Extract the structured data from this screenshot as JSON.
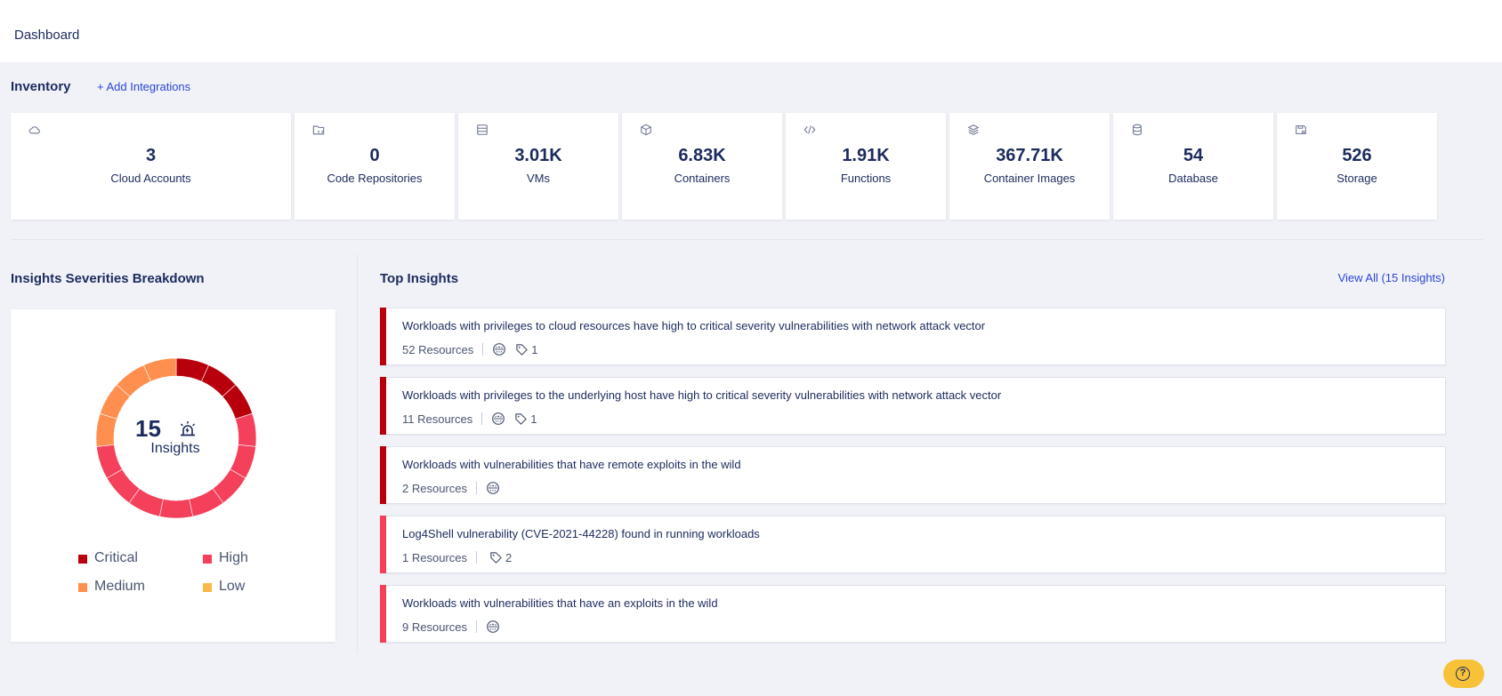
{
  "header": {
    "title": "Dashboard"
  },
  "inventory": {
    "title": "Inventory",
    "add_label": "+ Add Integrations",
    "cards": [
      {
        "value": "3",
        "label": "Cloud Accounts",
        "icon": "cloud-icon"
      },
      {
        "value": "0",
        "label": "Code Repositories",
        "icon": "folder-code-icon"
      },
      {
        "value": "3.01K",
        "label": "VMs",
        "icon": "server-icon"
      },
      {
        "value": "6.83K",
        "label": "Containers",
        "icon": "box-icon"
      },
      {
        "value": "1.91K",
        "label": "Functions",
        "icon": "code-icon"
      },
      {
        "value": "367.71K",
        "label": "Container Images",
        "icon": "layers-icon"
      },
      {
        "value": "54",
        "label": "Database",
        "icon": "database-icon"
      },
      {
        "value": "526",
        "label": "Storage",
        "icon": "storage-icon"
      }
    ]
  },
  "severities": {
    "title": "Insights Severities Breakdown",
    "total": "15",
    "total_label": "Insights",
    "legend": [
      {
        "label": "Critical",
        "color": "#b8000c"
      },
      {
        "label": "High",
        "color": "#f5405c"
      },
      {
        "label": "Medium",
        "color": "#fe8f4e"
      },
      {
        "label": "Low",
        "color": "#f9b949"
      }
    ],
    "chart_data": {
      "type": "pie",
      "categories": [
        "Critical",
        "High",
        "Medium"
      ],
      "values": [
        3,
        8,
        4
      ]
    }
  },
  "top_insights": {
    "title": "Top Insights",
    "view_all": "View All (15 Insights)",
    "items": [
      {
        "title": "Workloads with privileges to cloud resources have high to critical severity vulnerabilities with network attack vector",
        "resources": "52 Resources",
        "tags": "1",
        "severity_color": "#b8000c"
      },
      {
        "title": "Workloads with privileges to the underlying host have high to critical severity vulnerabilities with network attack vector",
        "resources": "11 Resources",
        "tags": "1",
        "severity_color": "#b8000c"
      },
      {
        "title": "Workloads with vulnerabilities that have remote exploits in the wild",
        "resources": "2 Resources",
        "tags": "",
        "severity_color": "#b8000c"
      },
      {
        "title": "Log4Shell vulnerability (CVE-2021-44228) found in running workloads",
        "resources": "1 Resources",
        "tags": "2",
        "severity_color": "#f5405c"
      },
      {
        "title": "Workloads with vulnerabilities that have an exploits in the wild",
        "resources": "9 Resources",
        "tags": "",
        "severity_color": "#f5405c"
      }
    ]
  },
  "help": {
    "icon": "help-icon",
    "symbol": "?"
  }
}
